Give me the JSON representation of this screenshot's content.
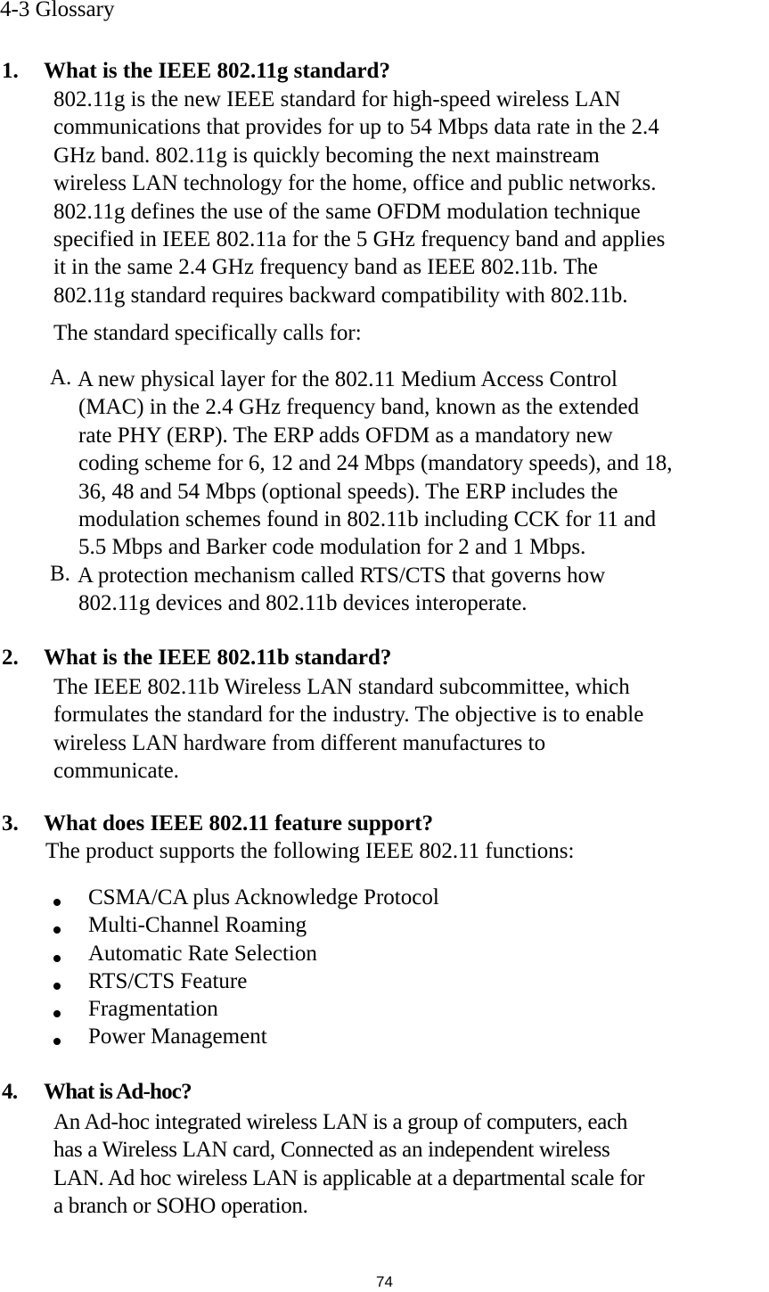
{
  "section_title": "4-3 Glossary",
  "questions": [
    {
      "number": "1.",
      "heading": "What is the IEEE 802.11g standard?",
      "lines": [
        "802.11g is the new IEEE standard for high-speed wireless LAN",
        "communications that provides for up to 54 Mbps data rate in the 2.4",
        "GHz band. 802.11g is quickly becoming the next mainstream",
        "wireless LAN technology for the home, office and public networks.",
        "802.11g defines the use of the same OFDM modulation technique",
        "specified in IEEE 802.11a for the 5 GHz frequency band and applies",
        "it in the same 2.4 GHz frequency band as IEEE 802.11b. The",
        "802.11g standard requires backward compatibility with 802.11b."
      ],
      "calls_for_intro": "The standard specifically calls for:",
      "items": [
        {
          "label": "A.",
          "lines": [
            "A new physical layer for the 802.11 Medium Access Control",
            "(MAC) in the 2.4 GHz frequency band, known as the extended",
            "rate PHY (ERP). The ERP adds OFDM as a mandatory new",
            "coding scheme for 6, 12 and 24 Mbps (mandatory speeds), and 18,",
            "36, 48 and 54 Mbps (optional speeds). The ERP includes the",
            "modulation schemes found in 802.11b including CCK for 11 and",
            "5.5 Mbps and Barker code modulation for 2 and 1 Mbps."
          ]
        },
        {
          "label": "B.",
          "lines": [
            "A protection mechanism called RTS/CTS that governs how",
            "802.11g devices and 802.11b devices interoperate."
          ]
        }
      ]
    },
    {
      "number": "2.",
      "heading": "What is the IEEE 802.11b standard?",
      "lines": [
        "The IEEE 802.11b Wireless LAN standard subcommittee, which",
        "formulates the standard for the industry. The objective is to enable",
        "wireless LAN hardware from different manufactures to",
        "communicate."
      ]
    },
    {
      "number": "3.",
      "heading": "What does IEEE 802.11 feature support?",
      "intro": "The product supports the following IEEE 802.11 functions:",
      "bullets": [
        "CSMA/CA plus Acknowledge Protocol",
        "Multi-Channel Roaming",
        "Automatic Rate Selection",
        "RTS/CTS Feature",
        "Fragmentation",
        "Power Management"
      ]
    },
    {
      "number": "4.",
      "heading": "What is Ad-hoc?",
      "lines": [
        "An Ad-hoc integrated wireless LAN is a group of computers, each",
        "has a Wireless LAN card, Connected as an independent wireless",
        "LAN. Ad hoc wireless LAN is applicable at a departmental scale for",
        "a branch or SOHO operation."
      ]
    }
  ],
  "page_number": "74"
}
